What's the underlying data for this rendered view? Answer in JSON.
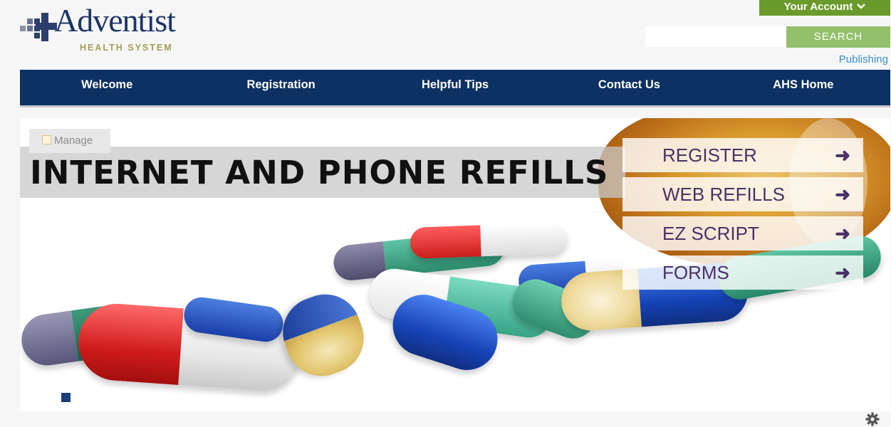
{
  "header": {
    "logo_name": "Adventist",
    "logo_sub": "HEALTH SYSTEM",
    "account_label": "Your Account",
    "search_placeholder": "",
    "search_button": "SEARCH",
    "publishing_link": "Publishing"
  },
  "nav": {
    "items": [
      "Welcome",
      "Registration",
      "Helpful Tips",
      "Contact Us",
      "AHS Home"
    ]
  },
  "banner": {
    "manage_label": "Manage",
    "headline": "INTERNET AND PHONE REFILLS",
    "menu": [
      {
        "label": "REGISTER"
      },
      {
        "label": "WEB REFILLS"
      },
      {
        "label": "EZ SCRIPT"
      },
      {
        "label": "FORMS"
      }
    ]
  },
  "icons": {
    "account_chevron": "chevron-down-icon",
    "menu_arrow": "arrow-right-icon",
    "manage": "pencil-icon",
    "settings": "gear-icon"
  },
  "colors": {
    "nav_bg": "#0d3162",
    "account_bg": "#6a9a2b",
    "search_bg": "#93c06a",
    "link": "#3a8fd0",
    "menu_text": "#4b3166"
  }
}
